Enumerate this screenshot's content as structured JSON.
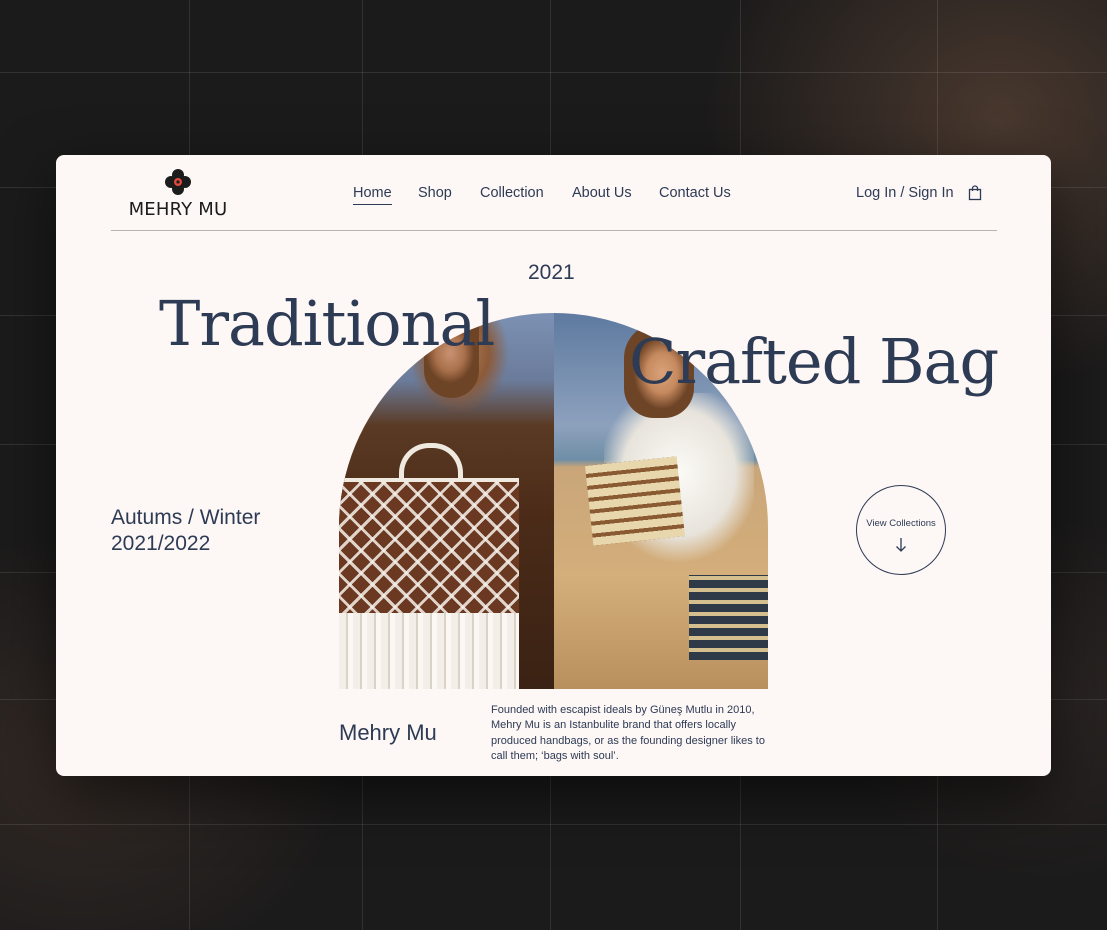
{
  "brand": {
    "logo_text": "MEHRY MU"
  },
  "nav": {
    "items": [
      {
        "label": "Home",
        "active": true
      },
      {
        "label": "Shop",
        "active": false
      },
      {
        "label": "Collection",
        "active": false
      },
      {
        "label": "About Us",
        "active": false
      },
      {
        "label": "Contact Us",
        "active": false
      }
    ],
    "login_label": "Log In / Sign In",
    "cart_icon": "shopping-bag-icon"
  },
  "hero": {
    "year": "2021",
    "title_part1": "Traditional",
    "title_part2": "Crafted Bag",
    "season_line1": "Autums / Winter",
    "season_line2": "2021/2022",
    "view_collections_label": "View Collections",
    "view_collections_icon": "arrow-down-icon"
  },
  "about": {
    "name": "Mehry Mu",
    "description": "Founded with escapist ideals by Güneş Mutlu in 2010, Mehry Mu is an Istanbulite brand that offers locally produced handbags, or as the founding designer likes to call them; ‘bags with soul’."
  },
  "colors": {
    "accent": "#2d3b54",
    "card_background": "#fdf7f6",
    "page_background": "#1c1b1b"
  }
}
